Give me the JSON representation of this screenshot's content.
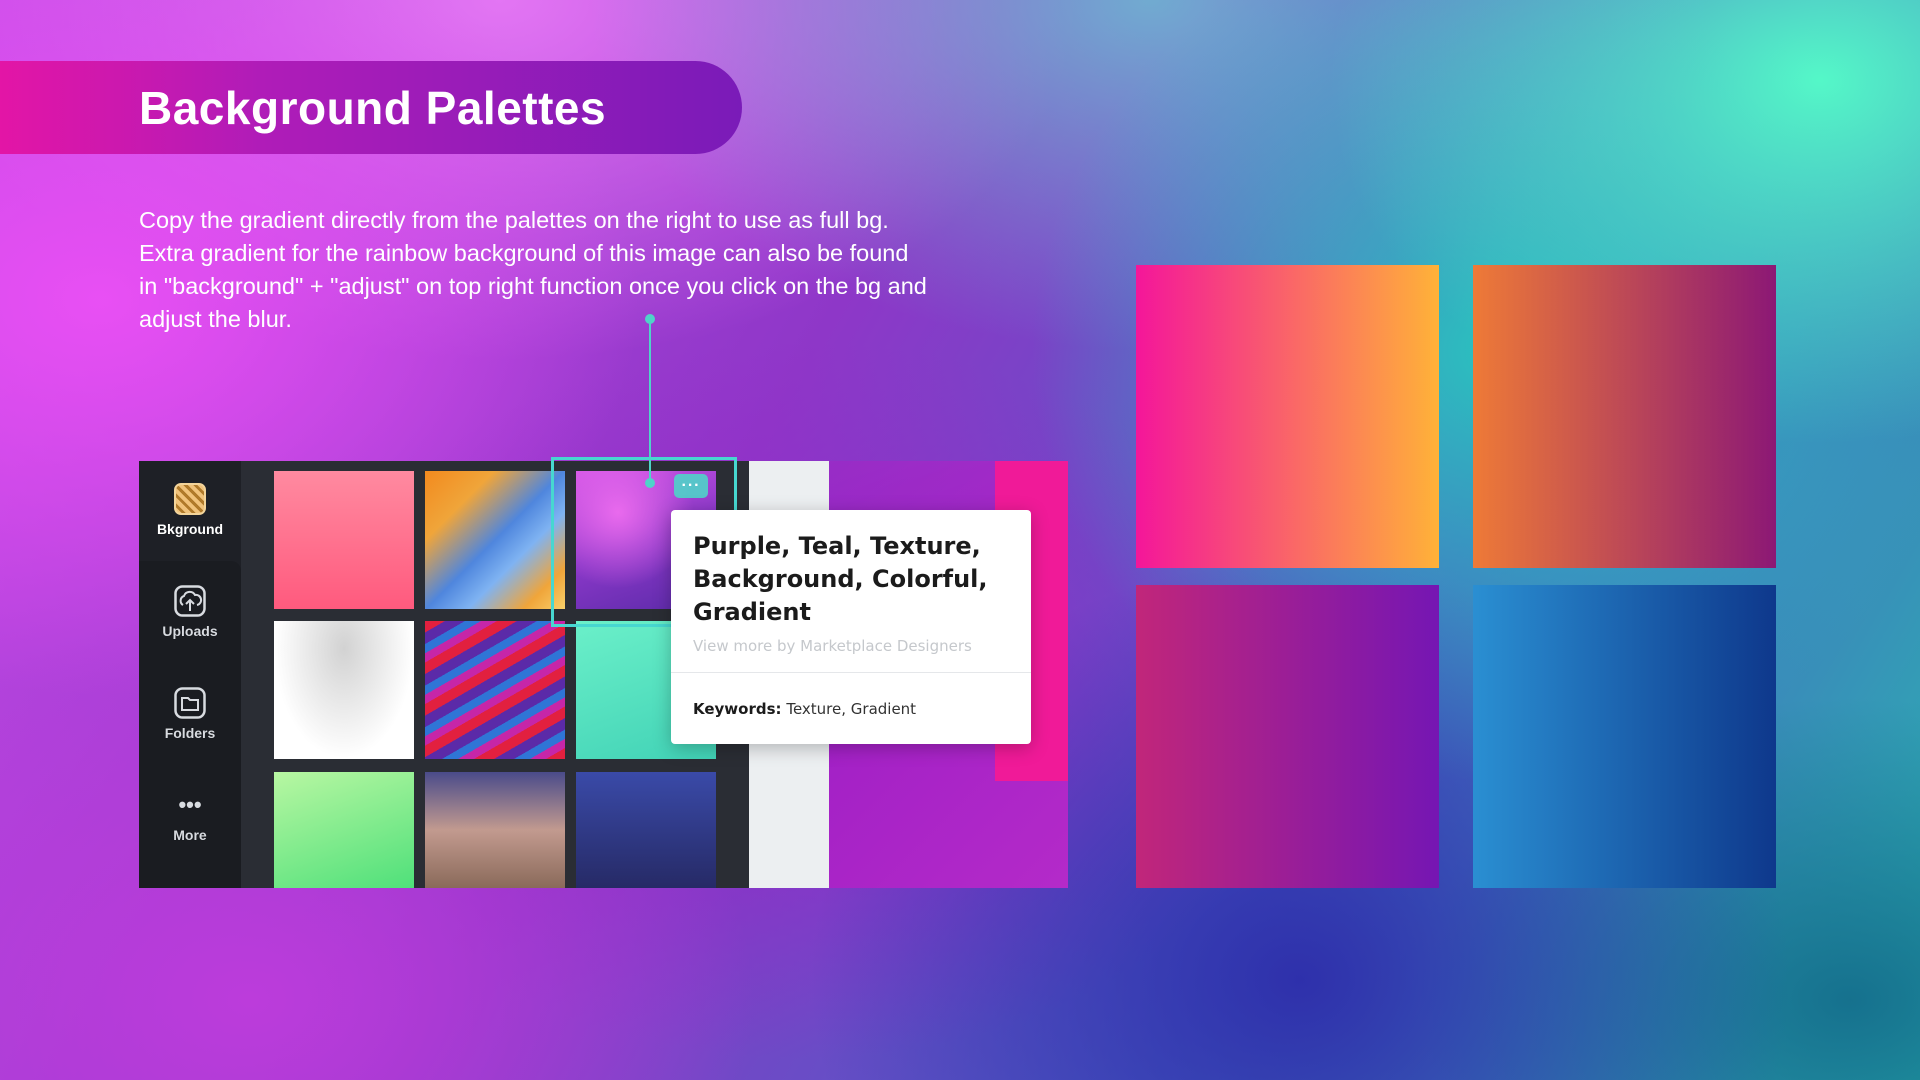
{
  "title": "Background Palettes",
  "description": [
    "Copy the gradient directly from the palettes on the right to use as full bg.",
    "Extra gradient for the rainbow background of this image can also be found",
    "in \"background\" + \"adjust\" on top right function once you click on the bg and",
    "adjust the blur."
  ],
  "canva": {
    "sidebar": [
      {
        "label": "Bkground",
        "icon": "background-icon"
      },
      {
        "label": "Uploads",
        "icon": "upload-icon"
      },
      {
        "label": "Folders",
        "icon": "folder-icon"
      },
      {
        "label": "More",
        "icon": "more-icon"
      }
    ],
    "more_dots": "···",
    "tooltip": {
      "title_lines": [
        "Purple, Teal, Texture,",
        "Background, Colorful,",
        "Gradient"
      ],
      "subtitle": "View more by Marketplace Designers",
      "keywords_label": "Keywords:",
      "keywords_value": "Texture, Gradient"
    }
  },
  "palettes": [
    {
      "name": "pink-orange",
      "from": "#f4169a",
      "to": "#ffb238"
    },
    {
      "name": "orange-purple",
      "from": "#ee7a37",
      "to": "#8c1875"
    },
    {
      "name": "crimson-violet",
      "from": "#c1267a",
      "to": "#7516b3"
    },
    {
      "name": "blue-navy",
      "from": "#2a8fd2",
      "to": "#0e388c"
    }
  ],
  "colors": {
    "accent_teal": "#47d7d0",
    "banner_start": "#e315a6",
    "banner_end": "#7a1bb8"
  }
}
